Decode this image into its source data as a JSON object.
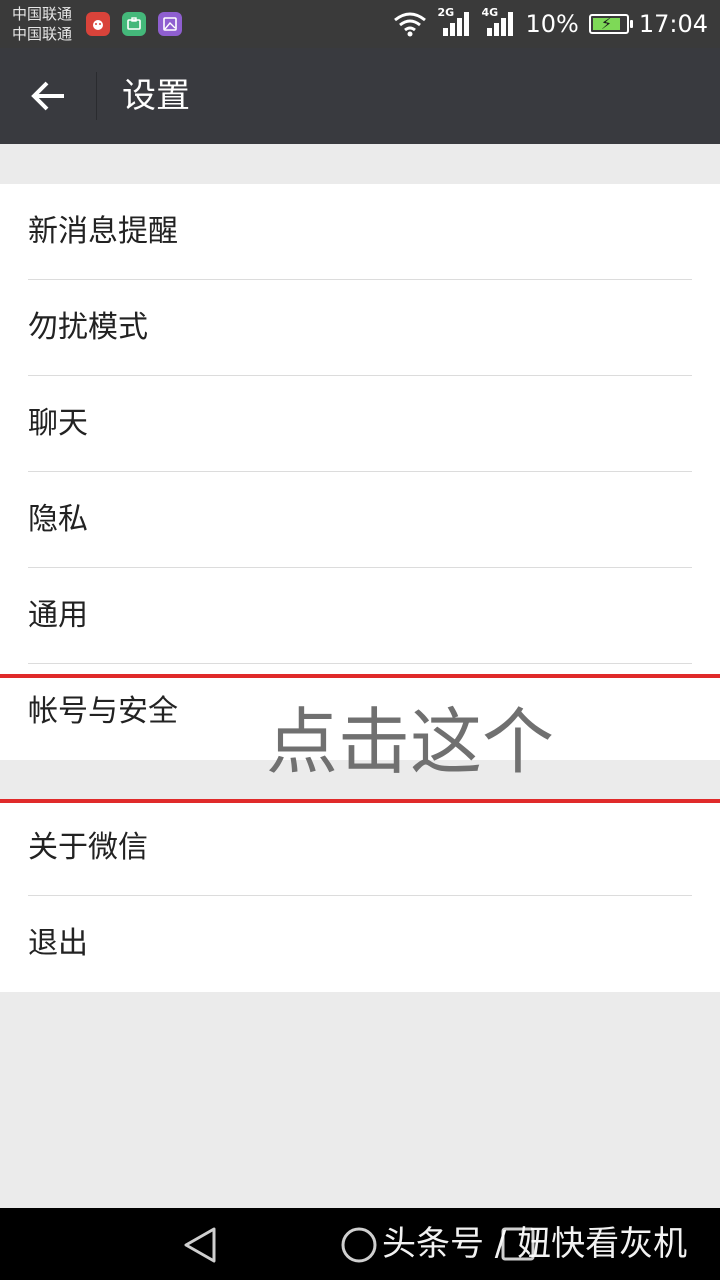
{
  "status_bar": {
    "carrier_1": "中国联通",
    "carrier_2": "中国联通",
    "net_2g": "2G",
    "net_4g": "4G",
    "battery_percent": "10%",
    "battery_level": 0.1,
    "time": "17:04",
    "app_icons": [
      "app-icon-red",
      "app-icon-green",
      "gallery-icon"
    ]
  },
  "header": {
    "title": "设置",
    "back_icon": "arrow-left-icon"
  },
  "settings": {
    "group1": [
      {
        "label": "新消息提醒"
      },
      {
        "label": "勿扰模式"
      },
      {
        "label": "聊天"
      },
      {
        "label": "隐私"
      },
      {
        "label": "通用"
      },
      {
        "label": "帐号与安全"
      }
    ],
    "group2": [
      {
        "label": "关于微信"
      },
      {
        "label": "退出"
      }
    ]
  },
  "annotation": {
    "text": "点击这个",
    "highlight_color": "#e02a2a"
  },
  "nav_bar": {
    "icons": [
      "triangle-back-icon",
      "circle-home-icon",
      "square-recent-icon"
    ]
  },
  "watermark": {
    "text": "头条号 / 妞快看灰机"
  },
  "colors": {
    "header_bg": "#393a3f",
    "page_bg": "#ebebeb",
    "status_bar_bg": "#3a3a3a"
  }
}
